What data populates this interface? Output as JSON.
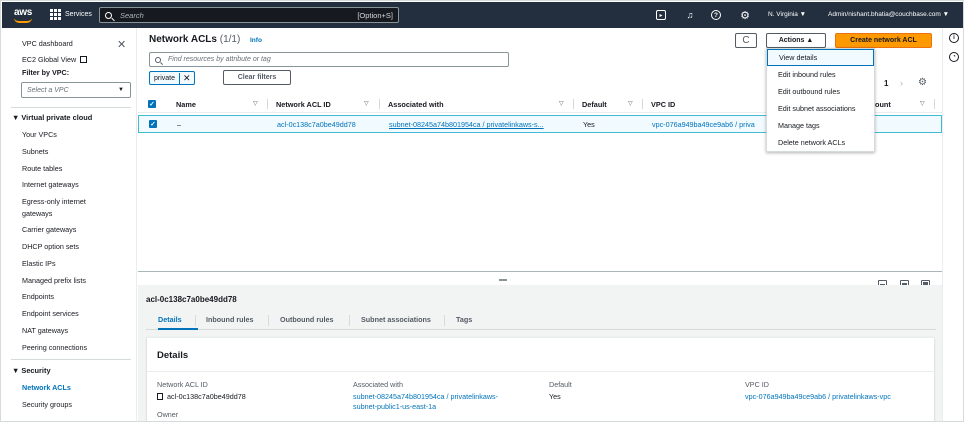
{
  "topnav": {
    "logo": "aws",
    "services": "Services",
    "search_placeholder": "Search",
    "search_shortcut": "[Option+S]",
    "icons": [
      "terminal-icon",
      "bell-icon",
      "help-icon",
      "gear-icon"
    ],
    "region": "N. Virginia ▼",
    "account": "Admin/nishant.bhatia@couchbase.com ▼"
  },
  "sidebar": {
    "title": "VPC dashboard",
    "ec2": "EC2 Global View",
    "filter_label": "Filter by VPC:",
    "filter_placeholder": "Select a VPC",
    "section_vpc": "Virtual private cloud",
    "items_vpc": [
      "Your VPCs",
      "Subnets",
      "Route tables",
      "Internet gateways",
      "Egress-only internet",
      "gateways",
      "Carrier gateways",
      "DHCP option sets",
      "Elastic IPs",
      "Managed prefix lists",
      "Endpoints",
      "Endpoint services",
      "NAT gateways",
      "Peering connections"
    ],
    "section_security": "Security",
    "items_security": [
      "Network ACLs",
      "Security groups"
    ]
  },
  "header": {
    "title": "Network ACLs",
    "count": "(1/1)",
    "info": "Info",
    "refresh": "C",
    "actions": "Actions ▲",
    "create": "Create network ACL",
    "filter_placeholder": "Find resources by attribute or tag",
    "token": "private",
    "clear": "Clear filters",
    "page": "1"
  },
  "table": {
    "columns": [
      "Name",
      "Network ACL ID",
      "Associated with",
      "Default",
      "VPC ID",
      "ount"
    ],
    "row": {
      "name": "–",
      "acl_id": "acl-0c138c7a0be49dd78",
      "associated": "subnet-08245a74b801954ca / privatelinkaws-s...",
      "default": "Yes",
      "vpc": "vpc-076a949ba49ce9ab6 / priva"
    }
  },
  "menu": [
    "View details",
    "Edit inbound rules",
    "Edit outbound rules",
    "Edit subnet associations",
    "Manage tags",
    "Delete network ACLs"
  ],
  "detail": {
    "title": "acl-0c138c7a0be49dd78",
    "tabs": [
      "Details",
      "Inbound rules",
      "Outbound rules",
      "Subnet associations",
      "Tags"
    ],
    "card_title": "Details",
    "fields": {
      "acl_label": "Network ACL ID",
      "acl_value": "acl-0c138c7a0be49dd78",
      "assoc_label": "Associated with",
      "assoc_value1": "subnet-08245a74b801954ca / privatelinkaws-",
      "assoc_value2": "subnet-public1-us-east-1a",
      "default_label": "Default",
      "default_value": "Yes",
      "vpc_label": "VPC ID",
      "vpc_value": "vpc-076a949ba49ce9ab6 / privatelinkaws-vpc",
      "owner_label": "Owner"
    }
  }
}
